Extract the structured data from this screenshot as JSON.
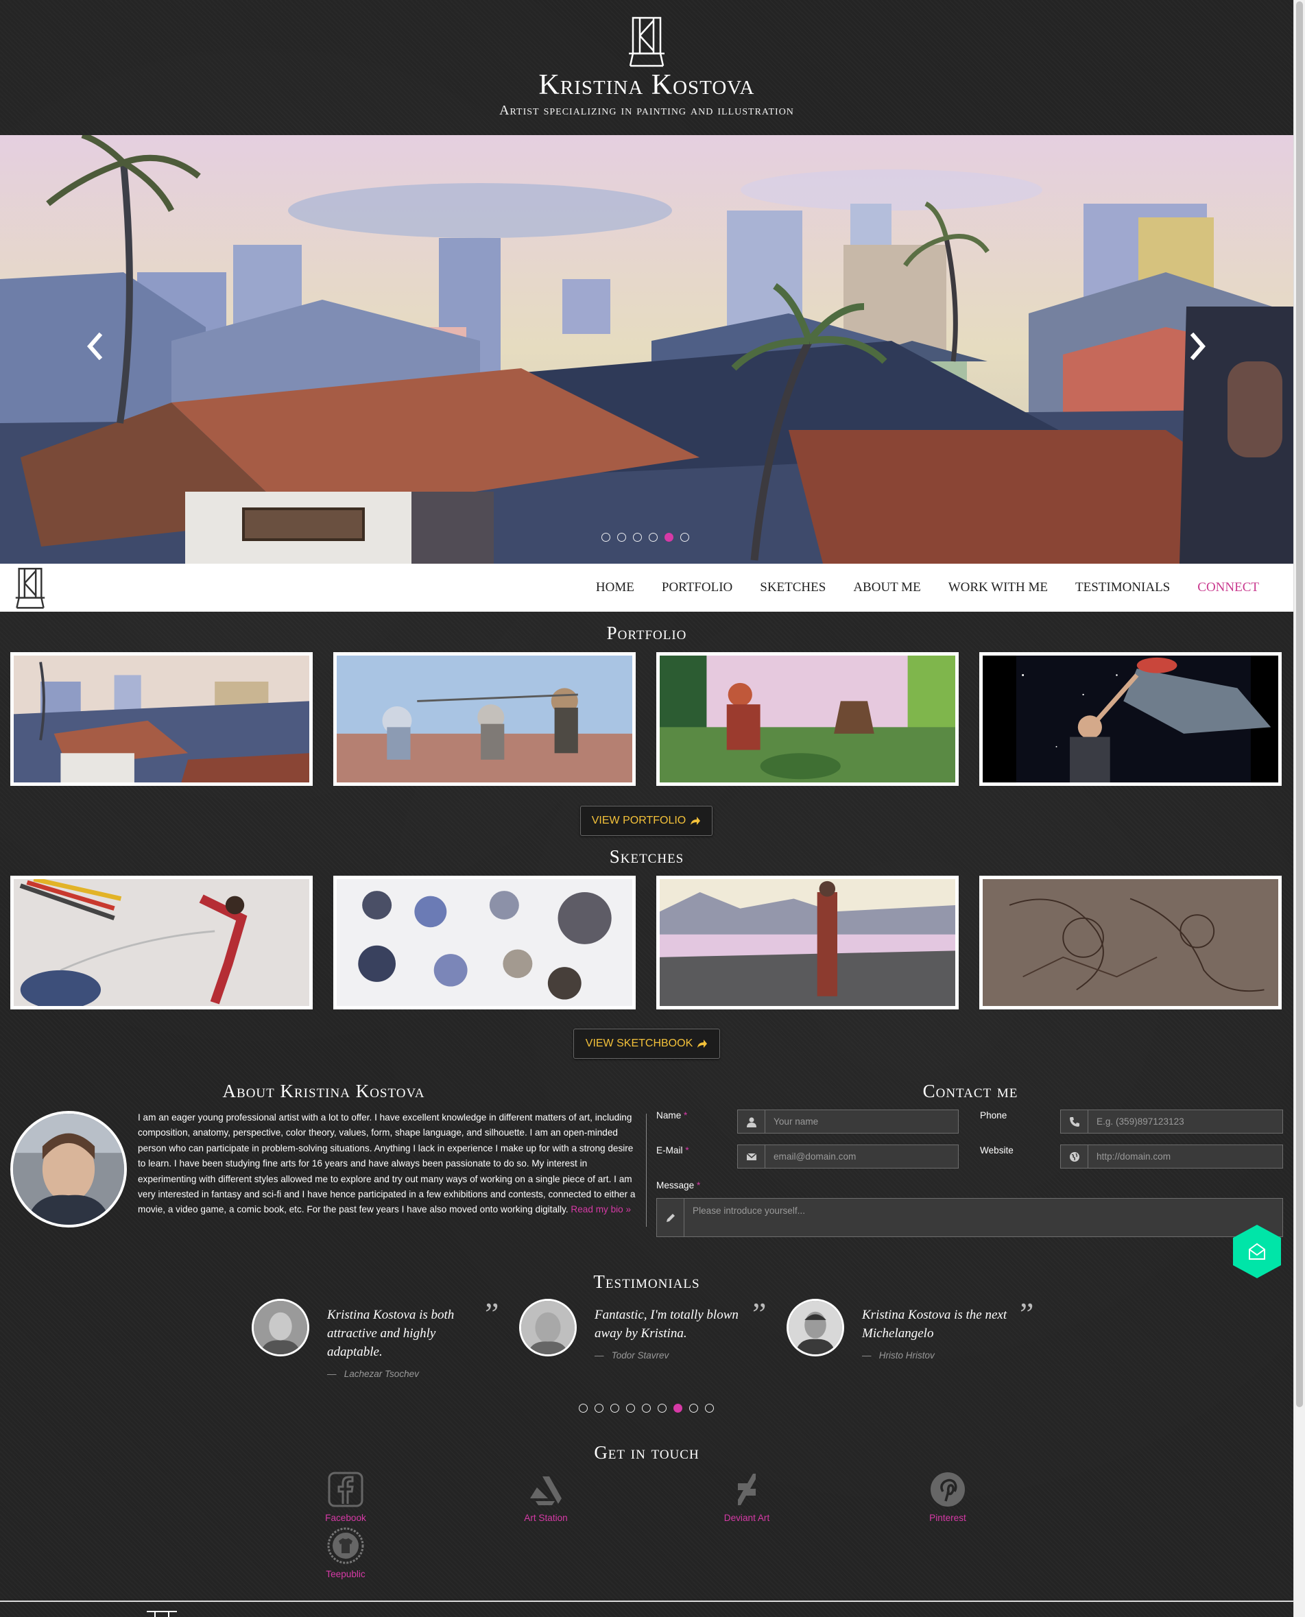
{
  "header": {
    "title": "Kristina Kostova",
    "tagline": "Artist specializing in painting and illustration"
  },
  "hero": {
    "dot_count": 6,
    "active_dot": 5
  },
  "nav": {
    "items": [
      "HOME",
      "PORTFOLIO",
      "SKETCHES",
      "ABOUT ME",
      "WORK WITH ME",
      "TESTIMONIALS",
      "CONNECT"
    ],
    "active": "CONNECT"
  },
  "portfolio": {
    "title": "Portfolio",
    "button": "VIEW PORTFOLIO"
  },
  "sketches": {
    "title": "Sketches",
    "button": "VIEW SKETCHBOOK"
  },
  "about": {
    "title": "About Kristina Kostova",
    "text": "I am an eager young professional artist with a lot to offer. I have excellent knowledge in different matters of art, including composition, anatomy, perspective, color theory, values, form, shape language, and silhouette. I am an open-minded person who can participate in problem-solving situations. Anything I lack in experience I make up for with a strong desire to learn. I have been studying fine arts for 16 years and have always been passionate to do so. My interest in experimenting with different styles allowed me to explore and try out many ways of working on a single piece of art. I am very interested in fantasy and sci-fi and I have hence participated in a few exhibitions and contests, connected to either a movie, a video game, a comic book, etc. For the past few years I have also moved onto working digitally.",
    "read_more": "Read my bio »"
  },
  "contact": {
    "title": "Contact me",
    "name_label": "Name",
    "name_placeholder": "Your name",
    "phone_label": "Phone",
    "phone_placeholder": "E.g. (359)897123123",
    "email_label": "E-Mail",
    "email_placeholder": "email@domain.com",
    "website_label": "Website",
    "website_placeholder": "http://domain.com",
    "message_label": "Message",
    "message_placeholder": "Please introduce yourself...",
    "required_mark": "*",
    "accent_color": "#00e5a8"
  },
  "testimonials": {
    "title": "Testimonials",
    "items": [
      {
        "quote": "Kristina Kostova is both attractive and highly adaptable.",
        "author": "Lachezar Tsochev"
      },
      {
        "quote": "Fantastic, I'm totally blown away by Kristina.",
        "author": "Todor Stavrev"
      },
      {
        "quote": "Kristina Kostova is the next Michelangelo",
        "author": "Hristo Hristov"
      }
    ],
    "dash": "—",
    "quote_mark": "”",
    "dot_count": 9,
    "active_dot": 7
  },
  "social": {
    "title": "Get in touch",
    "items": [
      {
        "label": "Facebook",
        "icon": "facebook-icon"
      },
      {
        "label": "Art Station",
        "icon": "artstation-icon"
      },
      {
        "label": "Deviant Art",
        "icon": "deviantart-icon"
      },
      {
        "label": "Pinterest",
        "icon": "pinterest-icon"
      },
      {
        "label": "Teepublic",
        "icon": "teepublic-icon"
      }
    ]
  },
  "colors": {
    "accent_pink": "#d63aa6",
    "button_text": "#f3c13a"
  }
}
